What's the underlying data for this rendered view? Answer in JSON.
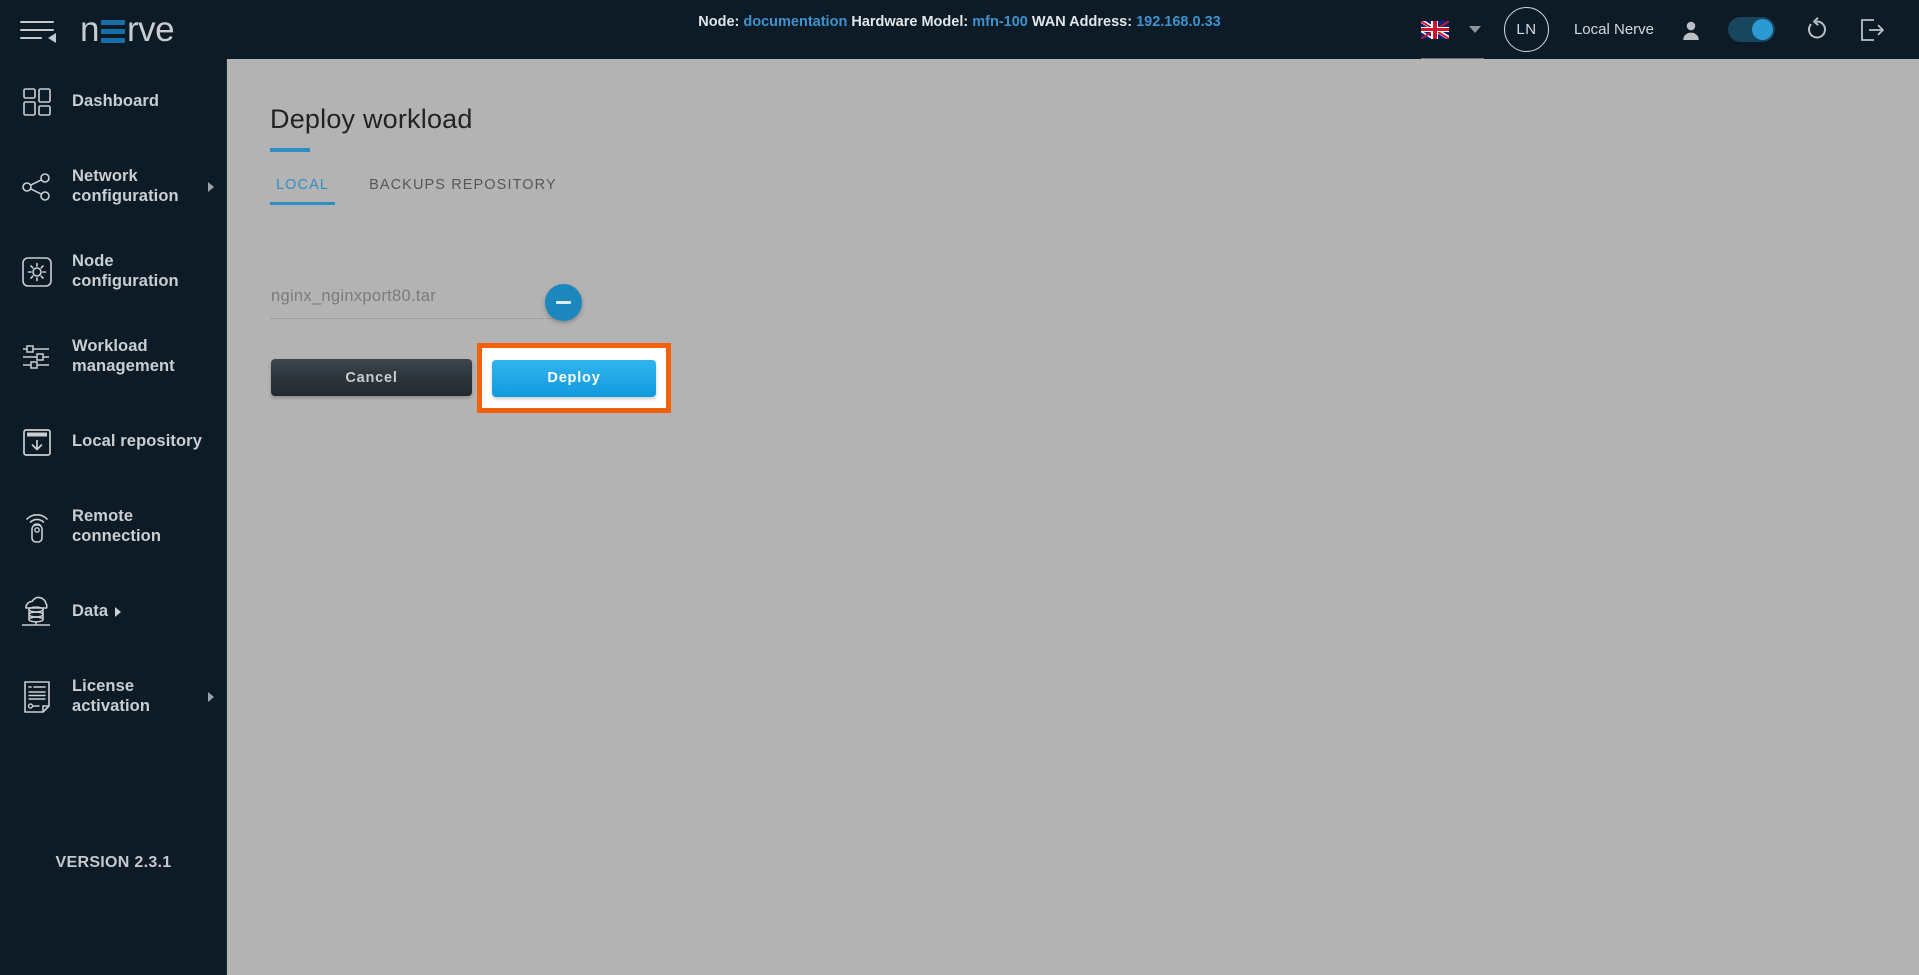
{
  "header": {
    "logo_text_before": "n",
    "logo_icon": "equals-bars-icon",
    "logo_text_after": "rve",
    "node_label": "Node:",
    "node_value": "documentation",
    "hardware_label": "Hardware Model:",
    "hardware_value": "mfn-100",
    "wan_label": "WAN Address:",
    "wan_value": "192.168.0.33",
    "language_flag": "uk-flag-icon",
    "avatar_initials": "LN",
    "username": "Local Nerve",
    "user_icon": "person-icon",
    "toggle_state": "on",
    "restart_icon": "restart-icon",
    "logout_icon": "logout-icon",
    "menu_icon": "hamburger-menu-icon"
  },
  "sidebar": {
    "items": [
      {
        "label": "Dashboard",
        "icon": "dashboard-grid-icon",
        "has_arrow": false,
        "inline_arrow": false
      },
      {
        "label": "Network\nconfiguration",
        "icon": "network-share-icon",
        "has_arrow": true,
        "inline_arrow": false
      },
      {
        "label": "Node\nconfiguration",
        "icon": "node-gear-icon",
        "has_arrow": false,
        "inline_arrow": false
      },
      {
        "label": "Workload\nmanagement",
        "icon": "sliders-icon",
        "has_arrow": false,
        "inline_arrow": false
      },
      {
        "label": "Local repository",
        "icon": "repository-download-icon",
        "has_arrow": false,
        "inline_arrow": false
      },
      {
        "label": "Remote\nconnection",
        "icon": "remote-signal-icon",
        "has_arrow": false,
        "inline_arrow": false
      },
      {
        "label": "Data",
        "icon": "cloud-database-icon",
        "has_arrow": false,
        "inline_arrow": true
      },
      {
        "label": "License\nactivation",
        "icon": "license-document-icon",
        "has_arrow": true,
        "inline_arrow": false
      }
    ],
    "version": "VERSION 2.3.1"
  },
  "main": {
    "page_title": "Deploy workload",
    "tabs": [
      {
        "label": "LOCAL",
        "active": true
      },
      {
        "label": "BACKUPS REPOSITORY",
        "active": false
      }
    ],
    "file_name": "nginx_nginxport80.tar",
    "remove_icon": "minus-circle-icon",
    "cancel_label": "Cancel",
    "deploy_label": "Deploy"
  },
  "colors": {
    "dark_bg": "#0d1b26",
    "page_bg": "#b3b3b3",
    "accent_blue": "#2f8ec4",
    "deploy_blue": "#22a5e4",
    "highlight_orange": "#f4600b",
    "link_blue": "#3e93cf"
  }
}
